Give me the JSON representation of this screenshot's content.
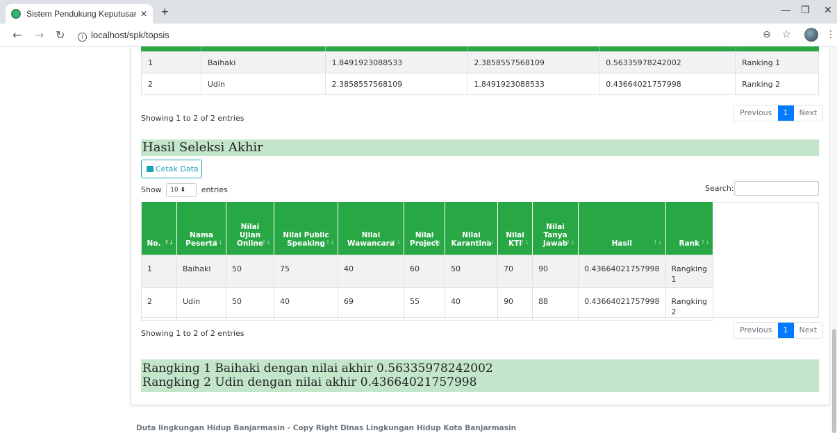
{
  "browser": {
    "tab_title": "Sistem Pendukung Keputusan Be",
    "url": "localhost/spk/topsis"
  },
  "colors": {
    "accent_green": "#28a745",
    "light_green": "#c3e6cb",
    "primary": "#007bff",
    "info": "#17a2b8"
  },
  "table1": {
    "rows": [
      {
        "no": "1",
        "nama": "Baihaki",
        "d_plus": "1.8491923088533",
        "d_minus": "2.3858557568109",
        "nilai": "0.56335978242002",
        "rank": "Ranking 1"
      },
      {
        "no": "2",
        "nama": "Udin",
        "d_plus": "2.3858557568109",
        "d_minus": "1.8491923088533",
        "nilai": "0.43664021757998",
        "rank": "Ranking 2"
      }
    ],
    "info": "Showing 1 to 2 of 2 entries",
    "pager": {
      "previous": "Previous",
      "page": "1",
      "next": "Next"
    }
  },
  "hasil": {
    "title": "Hasil Seleksi Akhir",
    "cetak_label": "Cetak Data",
    "show_label": "Show",
    "show_value": "10",
    "entries_label": "entries",
    "search_label": "Search:",
    "headers": [
      "No.",
      "Nama Peserta",
      "Nilai Ujian Online",
      "Nilai Public Speaking",
      "Nilai Wawancara",
      "Nilai Project",
      "Nilai Karantina",
      "Nilai KTI",
      "Nilai Tanya Jawab",
      "Hasil",
      "Rank"
    ],
    "rows": [
      [
        "1",
        "Baihaki",
        "50",
        "75",
        "40",
        "60",
        "50",
        "70",
        "90",
        "0.43664021757998",
        "Rangking 1"
      ],
      [
        "2",
        "Udin",
        "50",
        "40",
        "69",
        "55",
        "40",
        "90",
        "88",
        "0.43664021757998",
        "Rangking 2"
      ]
    ],
    "info": "Showing 1 to 2 of 2 entries",
    "pager": {
      "previous": "Previous",
      "page": "1",
      "next": "Next"
    }
  },
  "ranking_lines": [
    "Rangking 1 Baihaki dengan nilai akhir 0.56335978242002",
    "Rangking 2 Udin dengan nilai akhir 0.43664021757998"
  ],
  "footer": "Duta lingkungan Hidup Banjarmasin - Copy Right Dinas Lingkungan Hidup Kota Banjarmasin"
}
